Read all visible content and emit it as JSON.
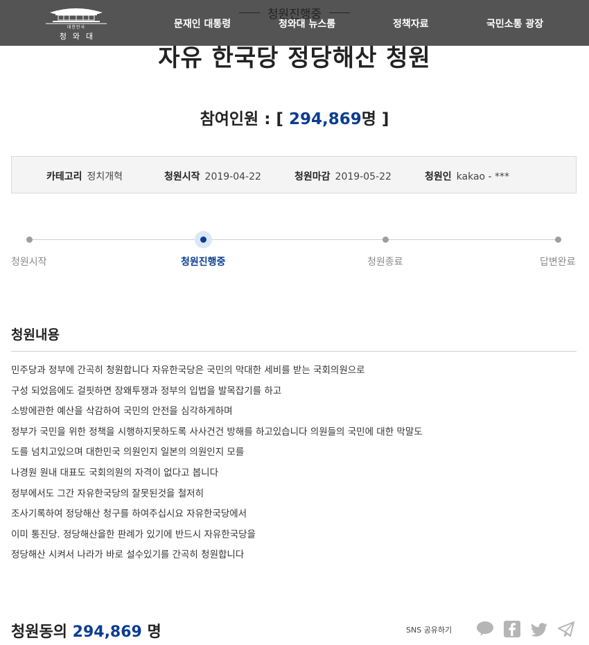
{
  "header": {
    "logo_small": "대한민국",
    "logo_text": "청와대",
    "nav": [
      "문재인 대통령",
      "청와대 뉴스룸",
      "정책자료",
      "국민소통 광장"
    ]
  },
  "status": "청원진행중",
  "petition": {
    "title": "자유 한국당 정당해산 청원",
    "participants_label": "참여인원 : [",
    "participants_count": "294,869",
    "participants_unit": "명 ]",
    "info": [
      {
        "label": "카테고리",
        "value": "정치개혁"
      },
      {
        "label": "청원시작",
        "value": "2019-04-22"
      },
      {
        "label": "청원마감",
        "value": "2019-05-22"
      },
      {
        "label": "청원인",
        "value": "kakao - ***"
      }
    ],
    "steps": [
      "청원시작",
      "청원진행중",
      "청원종료",
      "답변완료"
    ],
    "active_step": 1,
    "content_title": "청원내용",
    "content_lines": [
      "민주당과 정부에 간곡히 청원합니다 자유한국당은 국민의 막대한 세비를 받는 국회의원으로",
      "구성 되었음에도 걸핏하면 장왜투쟁과 정부의 입법을 발목잡기를 하고",
      "소방에관한 예산을 삭감하여 국민의 안전을 심각하게하며",
      "정부가 국민을 위한 정책을 시행하지못하도록 사사건건 방해를 하고있습니다 의원들의 국민에 대한 막말도",
      "도를 넘치고있으며 대한민국 의원인지 일본의 의원인지 모를",
      "나경원 원내 대표도 국회의원의 자격이 없다고 봅니다",
      "정부에서도 그간 자유한국당의 잘못된것을 철저히",
      "조사기록하여 정당해산 청구를 하여주십시요 자유한국당에서",
      "이미 통진당. 정당해산을한 판례가 있기에 반드시 자유한국당을",
      "정당해산 시켜서 나라가 바로 설수있기를 간곡히 청원합니다"
    ],
    "agree_label": "청원동의",
    "agree_count": "294,869",
    "agree_unit": "명"
  },
  "share": {
    "label": "SNS 공유하기",
    "icons": [
      "kakaotalk-icon",
      "facebook-icon",
      "twitter-icon",
      "telegram-icon"
    ]
  },
  "colors": {
    "header_bg": "#545454",
    "accent": "#0b3d91",
    "box_bg": "#f4f4f4",
    "icon_gray": "#b5b5b5"
  }
}
